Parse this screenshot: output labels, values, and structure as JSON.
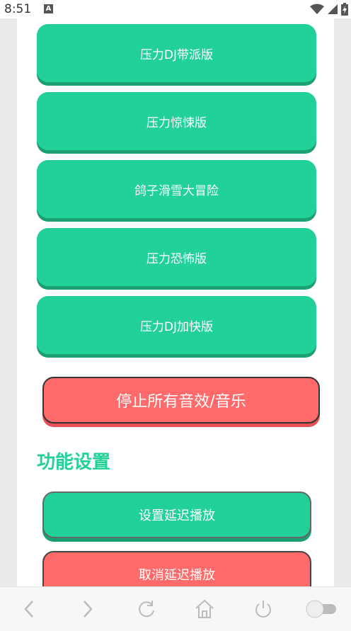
{
  "status_bar": {
    "time": "8:51",
    "notification_letter": "A"
  },
  "sound_buttons": [
    {
      "label": "压力DJ带派版"
    },
    {
      "label": "压力惊悚版"
    },
    {
      "label": "鸽子滑雪大冒险"
    },
    {
      "label": "压力恐怖版"
    },
    {
      "label": "压力DJ加快版"
    }
  ],
  "stop_button": {
    "label": "停止所有音效/音乐"
  },
  "settings": {
    "title": "功能设置",
    "set_delay_label": "设置延迟播放",
    "cancel_delay_label": "取消延迟播放"
  },
  "colors": {
    "accent_green": "#22d199",
    "accent_red": "#ff6b6b"
  },
  "nav_icons": [
    "back-icon",
    "forward-icon",
    "refresh-icon",
    "home-icon",
    "power-icon",
    "toggle-switch-icon"
  ]
}
